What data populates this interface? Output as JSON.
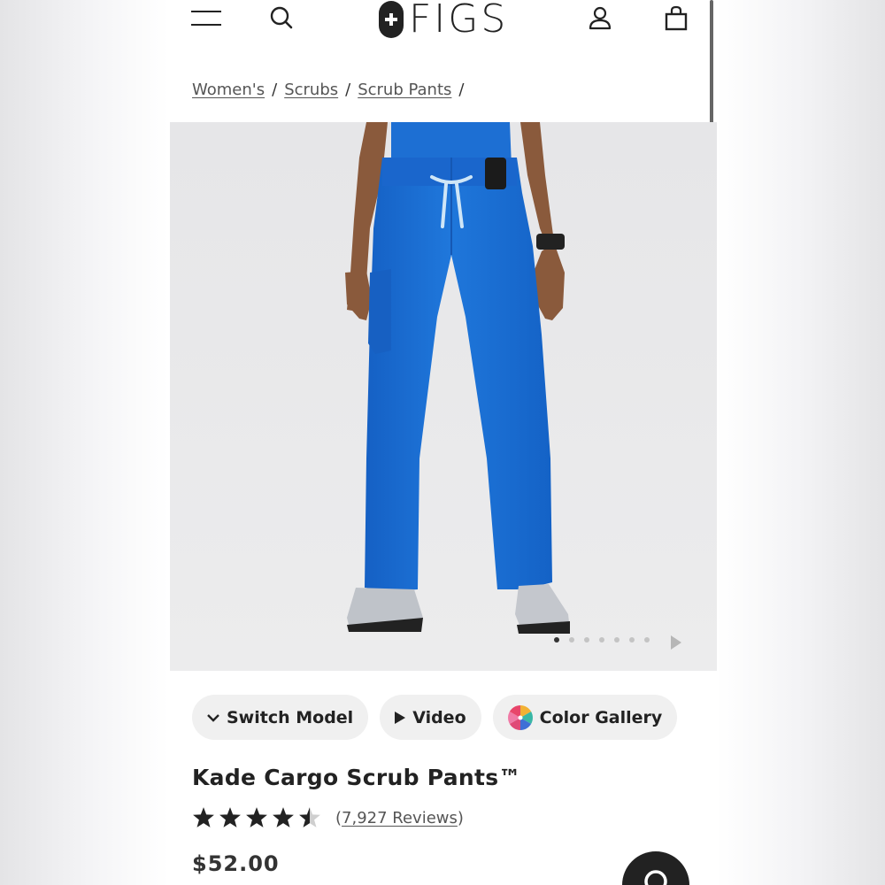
{
  "header": {
    "brand": "FIGS",
    "icons": [
      "menu-icon",
      "search-icon",
      "account-icon",
      "bag-icon"
    ]
  },
  "breadcrumb": {
    "items": [
      "Women's",
      "Scrubs",
      "Scrub Pants"
    ],
    "separator": "/"
  },
  "gallery": {
    "image_alt": "Model wearing royal blue Kade Cargo Scrub Pants",
    "current_slide": 1,
    "slide_count": 7
  },
  "chips": {
    "switch_model": "Switch Model",
    "video": "Video",
    "color_gallery": "Color Gallery"
  },
  "product": {
    "title": "Kade Cargo Scrub Pants™",
    "rating": 4.5,
    "rating_max": 5,
    "reviews_prefix": "(",
    "reviews_link": "7,927 Reviews",
    "reviews_suffix": ")",
    "price": "$52.00"
  },
  "colors": {
    "pants": "#1c6fd1",
    "text": "#222222",
    "chip_bg": "#f0f0f0"
  }
}
